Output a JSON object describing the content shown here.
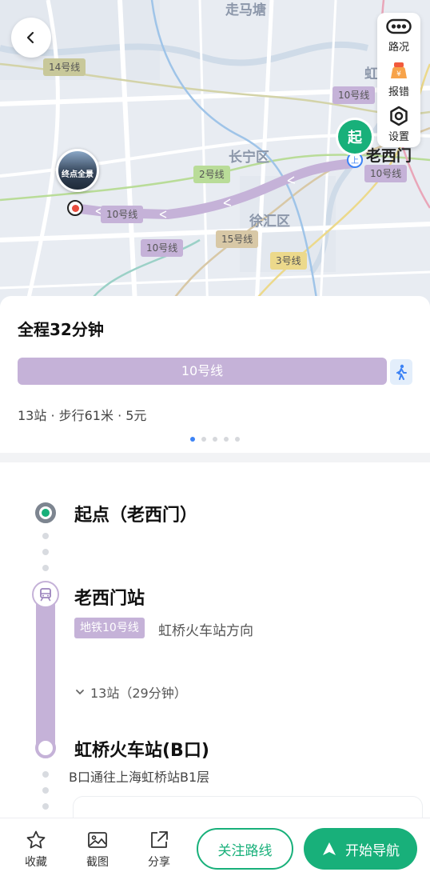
{
  "map": {
    "district_labels": [
      "走马塘",
      "长宁区",
      "徐汇区",
      "虹"
    ],
    "line_tags": [
      {
        "label": "14号线",
        "color": "#c8c89a"
      },
      {
        "label": "10号线",
        "color": "#c5b2d8"
      },
      {
        "label": "2号线",
        "color": "#b9dc98"
      },
      {
        "label": "10号线",
        "color": "#c5b2d8"
      },
      {
        "label": "10号线",
        "color": "#c5b2d8"
      },
      {
        "label": "15号线",
        "color": "#d8c8a6"
      },
      {
        "label": "10号线",
        "color": "#c5b2d8"
      },
      {
        "label": "3号线",
        "color": "#ecd98b"
      }
    ],
    "origin_pin_label": "起",
    "origin_name": "老西门",
    "dest_thumb_label": "终点全景",
    "tools": [
      {
        "label": "路况",
        "icon": "traffic-icon"
      },
      {
        "label": "报错",
        "icon": "report-icon"
      },
      {
        "label": "设置",
        "icon": "settings-icon"
      }
    ]
  },
  "summary": {
    "total": "全程32分钟",
    "segment_label": "10号线",
    "meta": "13站 · 步行61米 · 5元",
    "page_count": 5,
    "active_page": 1
  },
  "detail": {
    "start_title": "起点（老西门）",
    "board_station": "老西门站",
    "line_chip": "地铁10号线",
    "direction": "虹桥火车站方向",
    "stops": "13站（29分钟）",
    "alight_station": "虹桥火车站(B口)",
    "exit_note": "B口通往上海虹桥站B1层"
  },
  "bottom": {
    "items": [
      {
        "label": "收藏",
        "icon": "star-icon"
      },
      {
        "label": "截图",
        "icon": "image-icon"
      },
      {
        "label": "分享",
        "icon": "share-icon"
      }
    ],
    "follow": "关注路线",
    "navigate": "开始导航"
  },
  "colors": {
    "accent_green": "#18b07a",
    "line10_purple": "#c5b2d8",
    "page_dot_active": "#3d83f5"
  }
}
